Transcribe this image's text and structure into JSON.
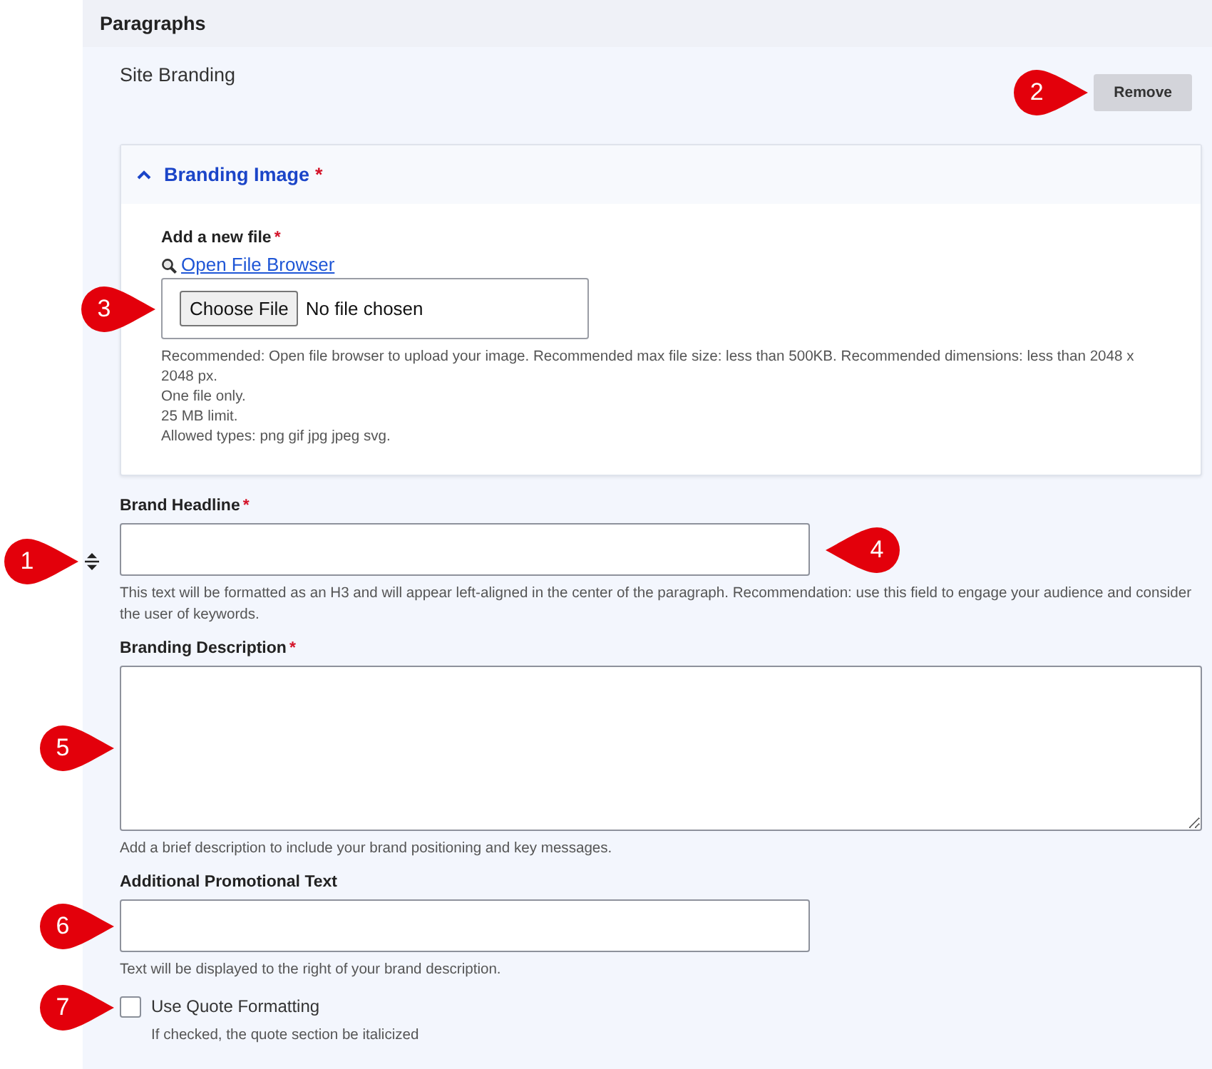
{
  "section": {
    "title": "Paragraphs"
  },
  "paragraph": {
    "title": "Site Branding",
    "handle_callout": {
      "number": "1",
      "points_left": false
    },
    "remove_button": {
      "label": "Remove",
      "callout": {
        "number": "2",
        "points_left": false
      }
    }
  },
  "branding_image": {
    "title": "Branding Image",
    "required_mark": "*",
    "expanded": true,
    "file_label": "Add a new file",
    "file_required_mark": "*",
    "browse_link": "Open File Browser",
    "choose_button": "Choose File",
    "file_status": "No file chosen",
    "file_callout": {
      "number": "3",
      "points_left": false
    },
    "help": [
      "Recommended: Open file browser to upload your image. Recommended max file size: less than 500KB. Recommended dimensions: less than 2048 x 2048 px.",
      "One file only.",
      "25 MB limit.",
      "Allowed types: png gif jpg jpeg svg."
    ]
  },
  "fields": [
    {
      "kind": "text",
      "label": "Brand Headline",
      "required_mark": "*",
      "help": "This text will be formatted as an H3 and will appear left-aligned in the center of the paragraph. Recommendation: use this field to engage your audience and consider the user of keywords.",
      "callout": {
        "number": "4",
        "points_left": true
      }
    },
    {
      "kind": "textarea",
      "label": "Branding Description",
      "required_mark": "*",
      "help": "Add a brief description to include your brand positioning and key messages.",
      "callout": {
        "number": "5",
        "points_left": false
      }
    },
    {
      "kind": "text",
      "label": "Additional Promotional Text",
      "help": "Text will be displayed to the right of your brand description.",
      "callout": {
        "number": "6",
        "points_left": false
      }
    },
    {
      "kind": "checkbox",
      "label": "Use Quote Formatting",
      "checked": false,
      "help": "If checked, the quote section be italicized",
      "callout": {
        "number": "7",
        "points_left": false
      }
    }
  ]
}
